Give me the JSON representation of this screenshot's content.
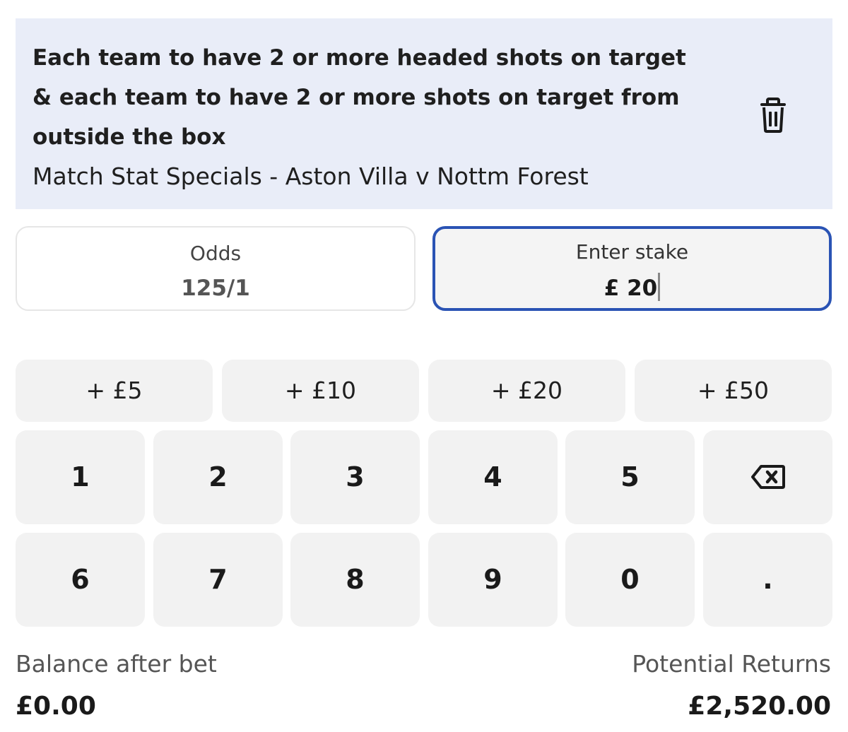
{
  "selection": {
    "title": "Each team to have 2 or more headed shots on target & each team to have 2 or more shots on target from outside the box",
    "market": "Match Stat Specials - Aston Villa v Nottm Forest",
    "delete_icon": "trash-icon"
  },
  "odds": {
    "label": "Odds",
    "value": "125/1"
  },
  "stake": {
    "label": "Enter stake",
    "value": "£ 20"
  },
  "quick_stakes": [
    "+ £5",
    "+ £10",
    "+ £20",
    "+ £50"
  ],
  "keypad": {
    "row1": [
      "1",
      "2",
      "3",
      "4",
      "5"
    ],
    "backspace_icon": "backspace-icon",
    "row2": [
      "6",
      "7",
      "8",
      "9",
      "0",
      "."
    ]
  },
  "footer": {
    "balance_label": "Balance after bet",
    "balance_value": "£0.00",
    "returns_label": "Potential Returns",
    "returns_value": "£2,520.00"
  },
  "colors": {
    "selection_bg": "#e9edf8",
    "stake_border": "#2a53b4",
    "key_bg": "#f2f2f2"
  }
}
